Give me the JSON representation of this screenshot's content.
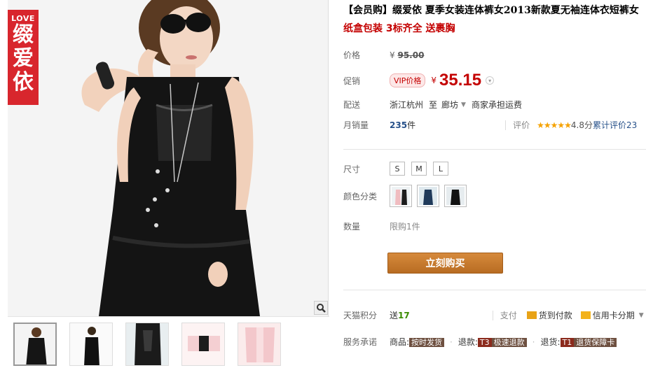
{
  "brand": {
    "love": "LOVE",
    "chars": [
      "缀",
      "爱",
      "依"
    ]
  },
  "product": {
    "title": "【会员购】缀爱依 夏季女装连体裤女2013新款夏无袖连体衣短裤女",
    "subtitle": "纸盒包装 3标齐全 送裹胸"
  },
  "price": {
    "label": "价格",
    "symbol": "¥",
    "original": "95.00",
    "promo_label": "促销",
    "vip_badge": "VIP价格",
    "current": "35.15"
  },
  "shipping": {
    "label": "配送",
    "from": "浙江杭州",
    "to_word": "至",
    "to": "廊坊",
    "fee_note": "商家承担运费"
  },
  "sales": {
    "label": "月销量",
    "count": "235",
    "unit": "件",
    "rating_label": "评价",
    "stars": "★★★★★",
    "score": "4.8分",
    "total_text": "累计评价",
    "total_count": "23"
  },
  "size": {
    "label": "尺寸",
    "options": [
      "S",
      "M",
      "L"
    ]
  },
  "color": {
    "label": "颜色分类"
  },
  "quantity": {
    "label": "数量",
    "limit": "限购1件"
  },
  "buy_button": "立刻购买",
  "points": {
    "label": "天猫积分",
    "prefix": "送",
    "value": "17",
    "pay_label": "支付",
    "pay_cod": "货到付款",
    "pay_credit": "信用卡分期"
  },
  "service": {
    "label": "服务承诺",
    "item1_prefix": "商品:",
    "item1_tag": "按时发货",
    "item2_prefix": "退款:",
    "item2_code": "T3",
    "item2_tag": "极速退款",
    "item3_prefix": "退货:",
    "item3_code": "T1",
    "item3_tag": "退货保障卡"
  },
  "colors": {
    "price_red": "#c40000",
    "buy_button": "#c87a2e",
    "brand_red": "#d8262d",
    "link_blue": "#27518a"
  }
}
